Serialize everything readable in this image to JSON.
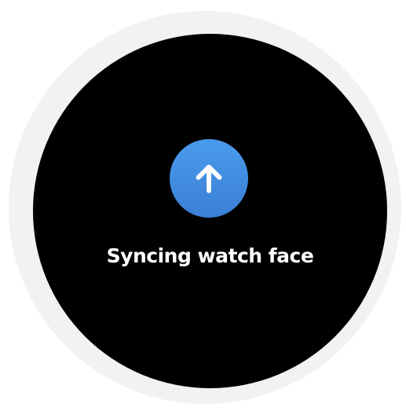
{
  "watch": {
    "status_text": "Syncing watch face",
    "icon": "arrow-up-icon",
    "colors": {
      "screen": "#000000",
      "bezel": "#f1f2f4",
      "icon_background": "#3f8ae0",
      "icon_arrow": "#ffffff",
      "text": "#ffffff"
    }
  }
}
